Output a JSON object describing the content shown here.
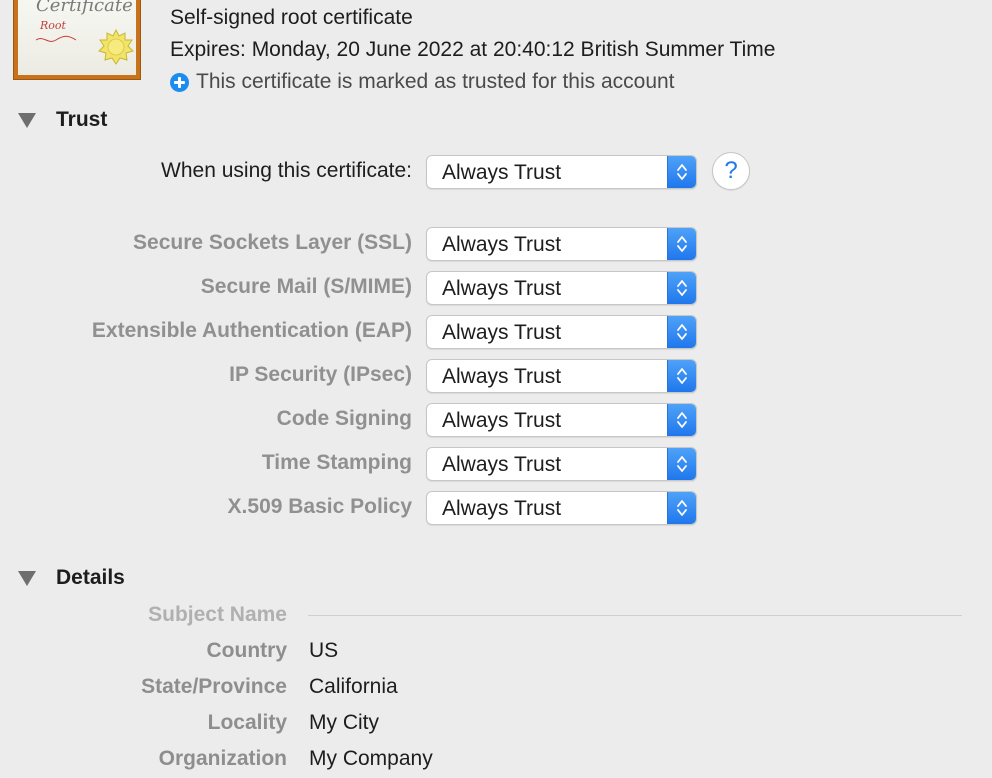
{
  "header": {
    "title": "Self-signed root certificate",
    "expires": "Expires: Monday, 20 June 2022 at 20:40:12 British Summer Time",
    "trusted_notice": "This certificate is marked as trusted for this account"
  },
  "certificate_icon": {
    "script_text": "Certificate",
    "root_text": "Root"
  },
  "trust": {
    "section_title": "Trust",
    "when_using_label": "When using this certificate:",
    "when_using_value": "Always Trust",
    "help_label": "?",
    "rows": [
      {
        "label": "Secure Sockets Layer (SSL)",
        "value": "Always Trust"
      },
      {
        "label": "Secure Mail (S/MIME)",
        "value": "Always Trust"
      },
      {
        "label": "Extensible Authentication (EAP)",
        "value": "Always Trust"
      },
      {
        "label": "IP Security (IPsec)",
        "value": "Always Trust"
      },
      {
        "label": "Code Signing",
        "value": "Always Trust"
      },
      {
        "label": "Time Stamping",
        "value": "Always Trust"
      },
      {
        "label": "X.509 Basic Policy",
        "value": "Always Trust"
      }
    ]
  },
  "details": {
    "section_title": "Details",
    "subject_name_label": "Subject Name",
    "fields": [
      {
        "label": "Country",
        "value": "US"
      },
      {
        "label": "State/Province",
        "value": "California"
      },
      {
        "label": "Locality",
        "value": "My City"
      },
      {
        "label": "Organization",
        "value": "My Company"
      }
    ]
  },
  "colors": {
    "accent": "#1f78ec",
    "background": "#ececec",
    "icon_frame": "#c8721c"
  }
}
